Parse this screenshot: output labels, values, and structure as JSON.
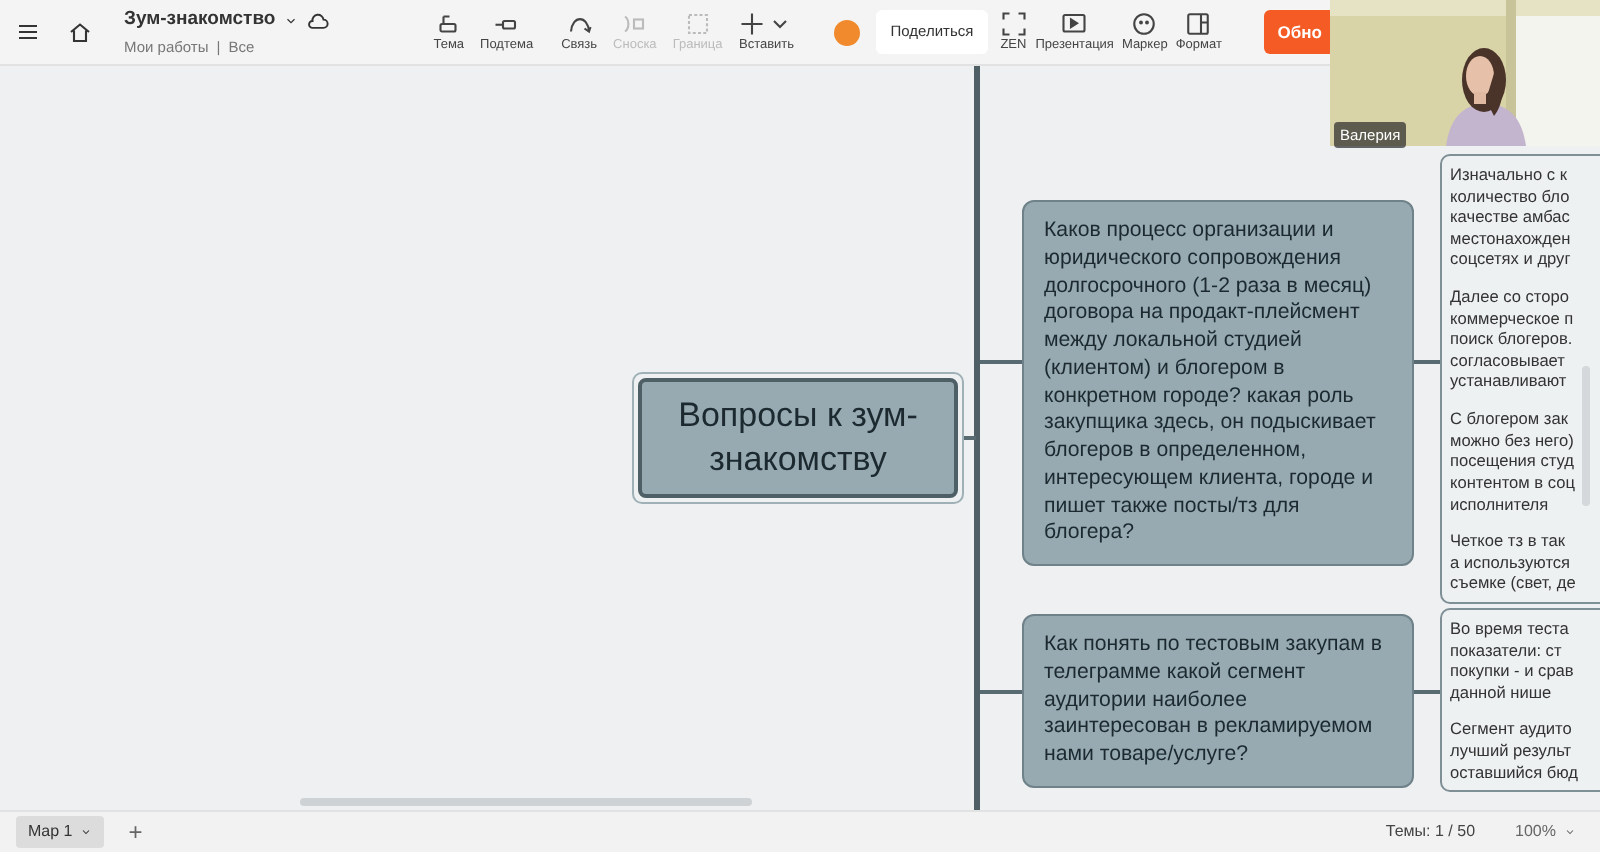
{
  "document": {
    "title": "Зум-знакомство",
    "breadcrumb": [
      "Мои работы",
      "Все"
    ],
    "breadcrumb_separator": "|"
  },
  "toolbar": [
    {
      "label": "Тема",
      "kind": "topic",
      "disabled": false
    },
    {
      "label": "Подтема",
      "kind": "subtopic",
      "disabled": false
    },
    {
      "label": "Связь",
      "kind": "relation",
      "disabled": false
    },
    {
      "label": "Сноска",
      "kind": "callout",
      "disabled": true
    },
    {
      "label": "Граница",
      "kind": "boundary",
      "disabled": true
    },
    {
      "label": "Вставить",
      "kind": "insert",
      "disabled": false
    }
  ],
  "share_button": "Поделиться",
  "view_tools": [
    {
      "label": "ZEN",
      "kind": "zen"
    },
    {
      "label": "Презентация",
      "kind": "play"
    },
    {
      "label": "Маркер",
      "kind": "marker"
    },
    {
      "label": "Формат",
      "kind": "format"
    }
  ],
  "update_button": "Обно",
  "video": {
    "participant": "Валерия"
  },
  "mindmap": {
    "central": "Вопросы к зум-знакомству",
    "topics": [
      {
        "text": "Каков процесс организации и юридического сопровождения долгосрочного (1-2 раза в месяц) договора на продакт-плейсмент между локальной студией (клиентом) и блогером в конкретном городе? какая роль закупщика здесь, он подыскивает блогеров в определенном, интересующем клиента, городе и пишет также посты/тз для блогера?",
        "note": [
          [
            "Изначально с к",
            "количество бло",
            "качестве амбас",
            "местонахожден",
            "соцсетях и друг"
          ],
          [
            "Далее со сторо",
            "коммерческое п",
            "поиск блогеров.",
            "согласовывает",
            "устанавливают"
          ],
          [
            "С блогером зак",
            "можно без него)",
            "посещения студ",
            "контентом в соц",
            "исполнителя"
          ],
          [
            "Четкое тз в так",
            "а используются",
            "съемке (свет, де"
          ]
        ]
      },
      {
        "text": "Как понять по тестовым закупам в телеграмме какой сегмент аудитории наиболее заинтересован в рекламируемом нами товаре/услуге?",
        "note": [
          [
            "Во время теста",
            "показатели: ст",
            "покупки - и срав",
            "данной нише"
          ],
          [
            "Сегмент аудито",
            "лучший результ",
            "оставшийся бюд"
          ]
        ]
      }
    ]
  },
  "footer": {
    "sheet_tab": "Map 1",
    "add_sheet": "+",
    "topic_count": "Темы: 1 / 50",
    "zoom": "100%"
  }
}
